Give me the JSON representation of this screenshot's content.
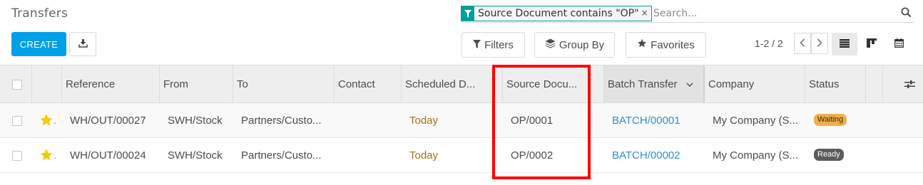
{
  "header": {
    "title": "Transfers"
  },
  "search": {
    "facet_label": "Source Document contains \"OP\"",
    "facet_remove": "×",
    "placeholder": "Search...",
    "value": ""
  },
  "toolbar": {
    "create_label": "CREATE",
    "filters_label": "Filters",
    "group_by_label": "Group By",
    "favorites_label": "Favorites",
    "pager_text": "1-2 / 2"
  },
  "table": {
    "columns": [
      "Reference",
      "From",
      "To",
      "Contact",
      "Scheduled D...",
      "Source Docu...",
      "Batch Transfer",
      "Company",
      "Status"
    ],
    "rows": [
      {
        "starred": true,
        "reference": "WH/OUT/00027",
        "from": "SWH/Stock",
        "to": "Partners/Custo...",
        "contact": "",
        "scheduled": "Today",
        "source": "OP/0001",
        "batch": "BATCH/00001",
        "company": "My Company (S...",
        "status": "Waiting"
      },
      {
        "starred": true,
        "reference": "WH/OUT/00024",
        "from": "SWH/Stock",
        "to": "Partners/Custo...",
        "contact": "",
        "scheduled": "Today",
        "source": "OP/0002",
        "batch": "BATCH/00002",
        "company": "My Company (S...",
        "status": "Ready"
      }
    ]
  },
  "colors": {
    "primary": "#00a0e9",
    "facet_accent": "#00a09d",
    "waiting_badge": "#f0ad4e",
    "ready_badge": "#5b5b5b",
    "star": "#f3cc00",
    "highlight": "#ff0000"
  }
}
